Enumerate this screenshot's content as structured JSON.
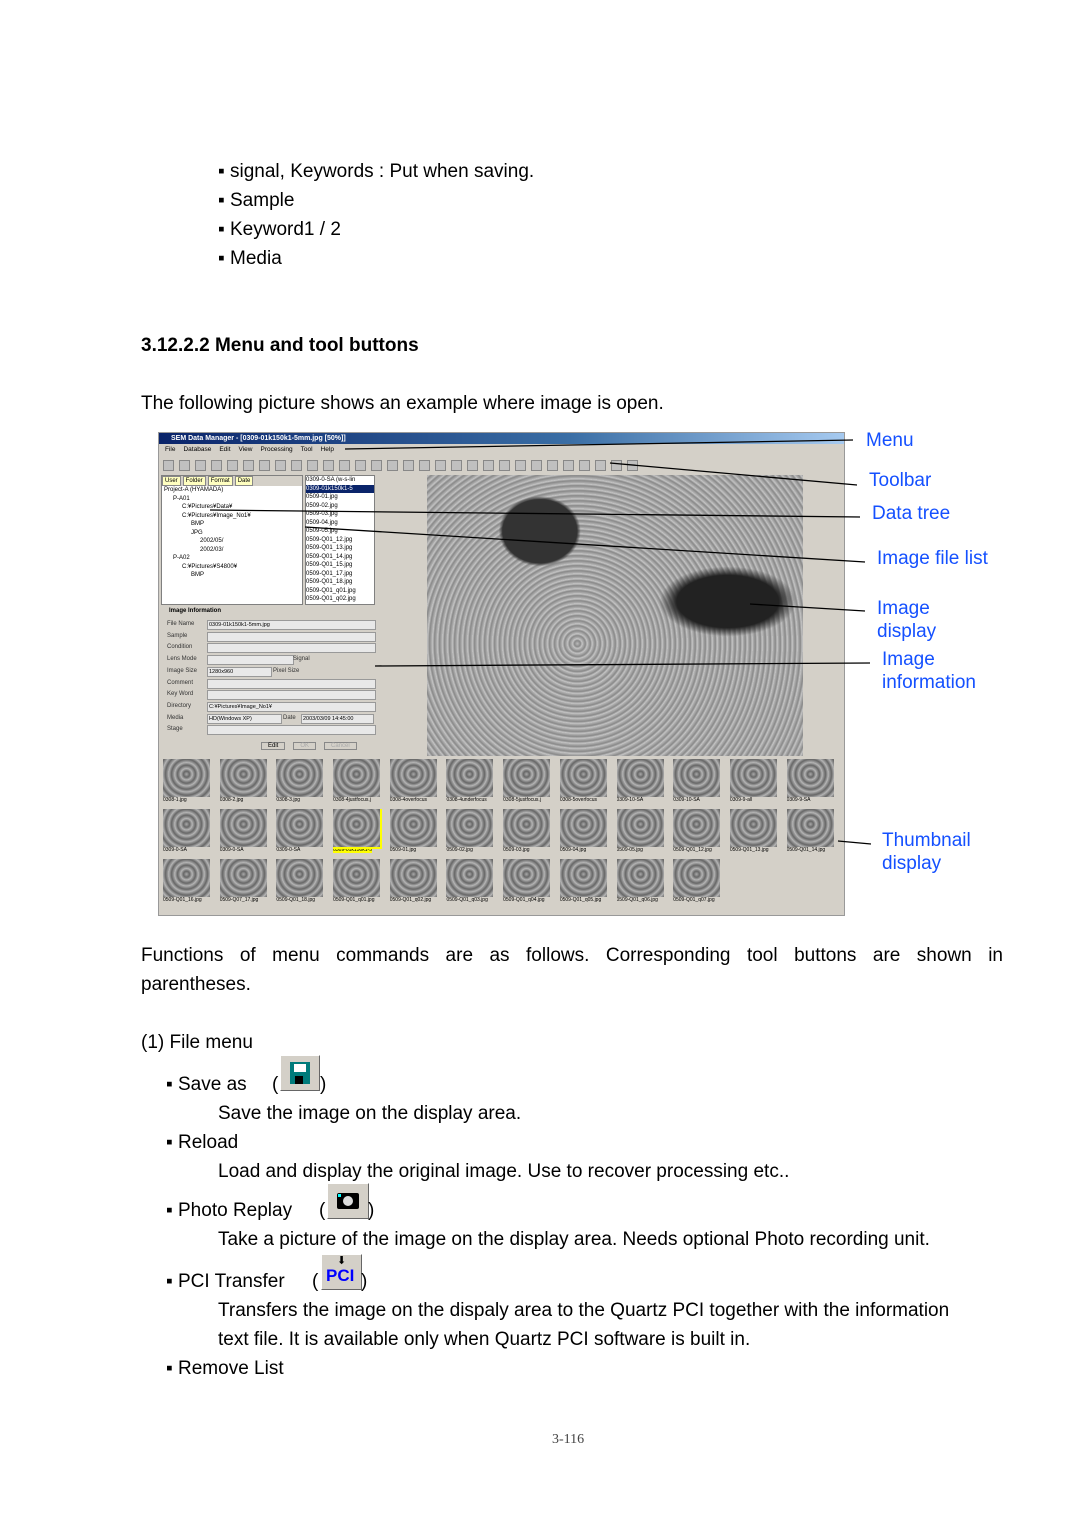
{
  "bullets_top": [
    "▪ signal, Keywords : Put when saving.",
    "▪ Sample",
    "▪ Keyword1 / 2",
    "▪ Media"
  ],
  "section_heading": "3.12.2.2 Menu and tool buttons",
  "intro": "The following picture shows an example where image is open.",
  "screenshot": {
    "title": "SEM Data Manager - [0309-01k150k1-5mm.jpg [50%]]",
    "menu": [
      "File",
      "Database",
      "Edit",
      "View",
      "Processing",
      "Tool",
      "Help"
    ],
    "filter": [
      "User",
      "Folder",
      "Format",
      "Date"
    ],
    "tree": [
      "Project-A (HYAMADA)",
      "P-A01",
      "C:¥Pictures¥Data¥",
      "C:¥Pictures¥Image_No1¥",
      "BMP",
      "JPG",
      "2002/05/",
      "2002/03/",
      "P-A02",
      "C:¥Pictures¥S4800¥",
      "BMP"
    ],
    "files": [
      "0309-0-SA (w-s-lin",
      "0309-01k150k1-5",
      "0509-01.jpg",
      "0509-02.jpg",
      "0509-03.jpg",
      "0509-04.jpg",
      "0509-05.jpg",
      "0509-Q01_12.jpg",
      "0509-Q01_13.jpg",
      "0509-Q01_14.jpg",
      "0509-Q01_15.jpg",
      "0509-Q01_17.jpg",
      "0509-Q01_18.jpg",
      "0509-Q01_q01.jpg",
      "0509-Q01_q02.jpg",
      "0509-Q01_q03.jpg"
    ],
    "info_title": "Image Information",
    "info": [
      {
        "label": "File Name",
        "value": "0309-01k150k1-5mm.jpg"
      },
      {
        "label": "Sample",
        "value": ""
      },
      {
        "label": "Condition",
        "value": ""
      },
      {
        "label": "Lens Mode",
        "value": ""
      },
      {
        "label": "Image Size",
        "value": "1280x960"
      },
      {
        "label": "Comment",
        "value": ""
      },
      {
        "label": "Key Word",
        "value": ""
      },
      {
        "label": "Directory",
        "value": "C:¥Pictures¥Image_No1¥"
      },
      {
        "label": "Media",
        "value": "HD(Windows XP)"
      },
      {
        "label": "Stage",
        "value": ""
      }
    ],
    "signal_label": "Signal",
    "pixel_label": "Pixel Size",
    "date_label": "Date",
    "date_value": "2003/03/09 14:45:00",
    "buttons": [
      "Edit",
      "OK",
      "Cancel"
    ],
    "thumbnails": [
      "0308-1.jpg",
      "0308-2.jpg",
      "0308-3.jpg",
      "0308-4justfocus.j",
      "0308-4overfocus",
      "0308-4underfocus",
      "0308-5justfocus.j",
      "0308-5overfocus",
      "0309-10-SA",
      "0309-10-SA",
      "0309-9-all",
      "0309-9-SA",
      "0309-0-SA",
      "0309-0-SA",
      "0309-0-SA",
      "0309-01k150k1-5",
      "0509-01.jpg",
      "0509-02.jpg",
      "0509-03.jpg",
      "0509-04.jpg",
      "0509-05.jpg",
      "0509-Q01_12.jpg",
      "0509-Q01_13.jpg",
      "0509-Q01_14.jpg",
      "0509-Q01_16.jpg",
      "0509-Q07_17.jpg",
      "0509-Q01_18.jpg",
      "0509-Q01_q01.jpg",
      "0509-Q01_q02.jpg",
      "0509-Q01_q03.jpg",
      "0509-Q01_q04.jpg",
      "0509-Q01_q05.jpg",
      "0509-Q01_q06.jpg",
      "0509-Q01_q07.jpg"
    ],
    "selected_thumbnail": 15
  },
  "callouts": {
    "menu": "Menu",
    "toolbar": "Toolbar",
    "data_tree": "Data tree",
    "image_file_list": "Image file list",
    "image_display_1": "Image",
    "image_display_2": "display",
    "image_info_1": "Image",
    "image_info_2": "information",
    "thumb_1": "Thumbnail",
    "thumb_2": "display"
  },
  "callout_color": "#1450ff",
  "functions_line1": "Functions of menu commands are as follows. Corresponding tool buttons are shown in",
  "functions_line2": "parentheses.",
  "file_menu": "(1) File menu",
  "items": {
    "save_as": "▪ Save as",
    "save_as_desc": "Save the image on the display area.",
    "save_icon": "floppy-disk-icon",
    "reload": "▪ Reload",
    "reload_desc": "Load and display the original image. Use to recover processing etc..",
    "photo": "▪ Photo Replay",
    "photo_desc": "Take a picture of the image on the display area. Needs optional Photo recording unit.",
    "photo_icon": "camera-icon",
    "pci": "▪ PCI Transfer",
    "pci_icon_text": "PCI",
    "pci_desc1": "Transfers the image on the dispaly area to the Quartz PCI together with the information",
    "pci_desc2": "text file.    It is available only when Quartz PCI software is built in.",
    "remove": "▪ Remove List"
  },
  "page_number": "3-116"
}
